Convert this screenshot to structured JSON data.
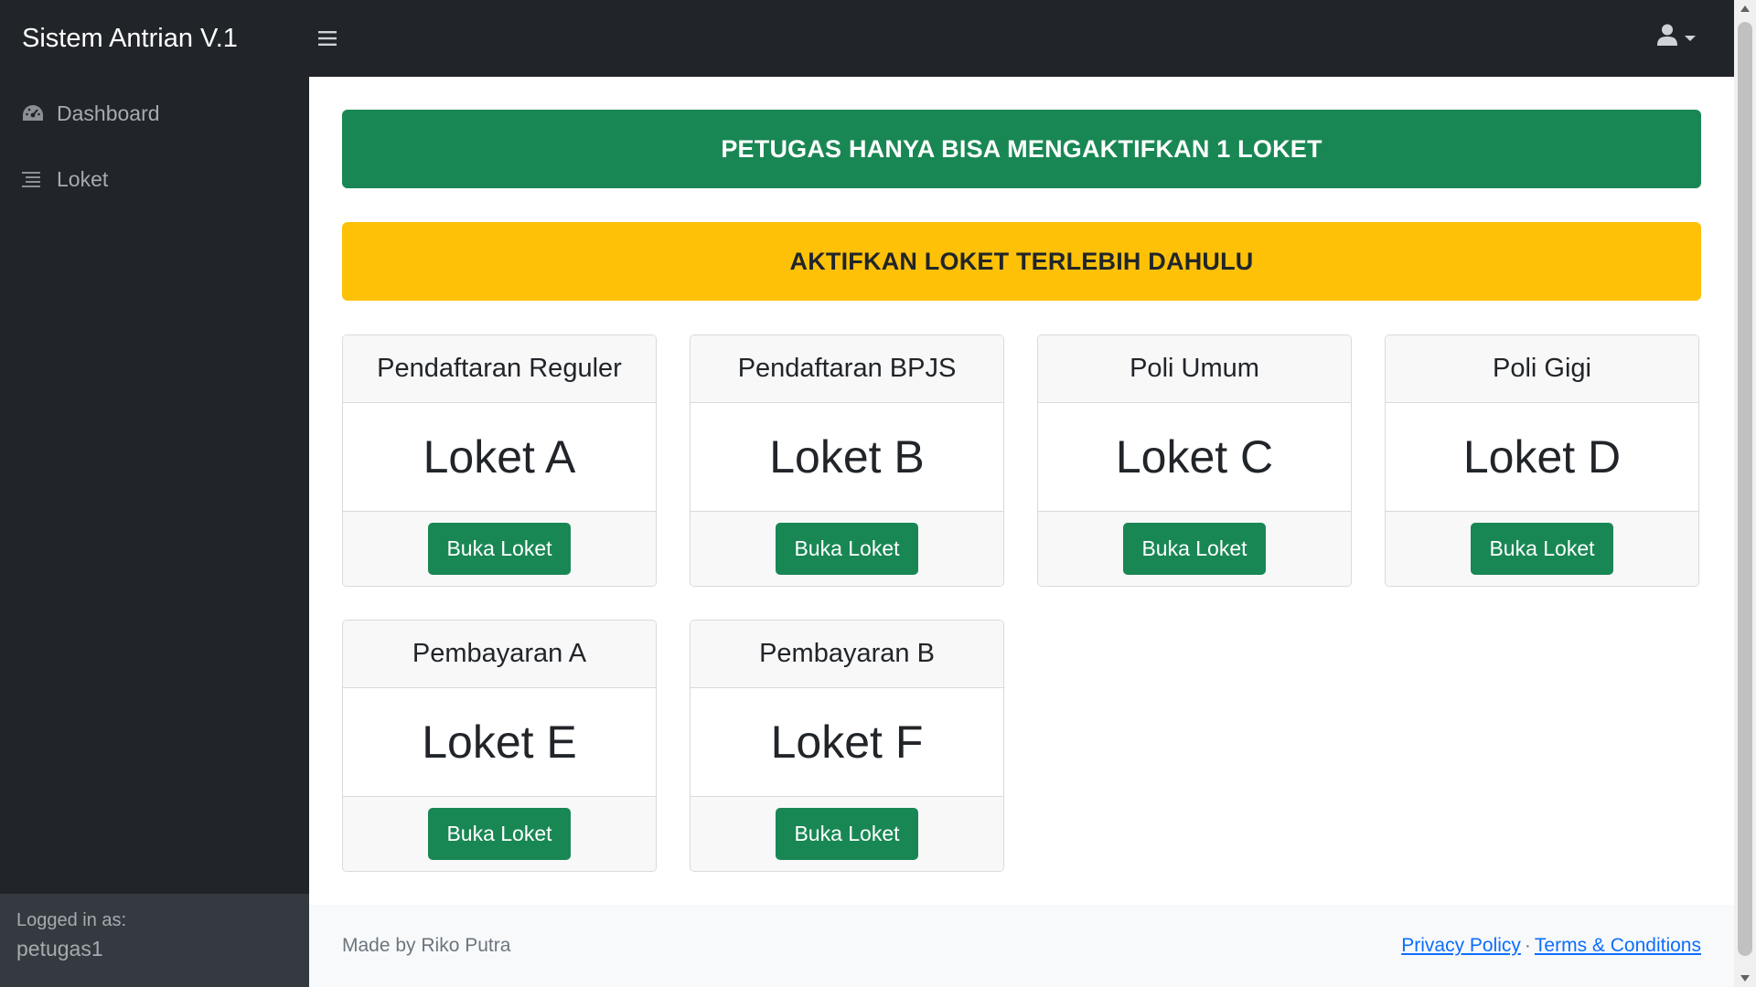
{
  "app": {
    "title": "Sistem Antrian V.1"
  },
  "topbar": {
    "toggle_icon": "menu-icon",
    "user_icon": "user-icon"
  },
  "sidebar": {
    "items": [
      {
        "label": "Dashboard",
        "icon": "dashboard-icon"
      },
      {
        "label": "Loket",
        "icon": "list-icon"
      }
    ],
    "footer": {
      "logged_in_label": "Logged in as:",
      "username": "petugas1"
    }
  },
  "banners": {
    "info": "PETUGAS HANYA BISA MENGAKTIFKAN 1 LOKET",
    "warning": "AKTIFKAN LOKET TERLEBIH DAHULU"
  },
  "counters": [
    {
      "service": "Pendaftaran Reguler",
      "name": "Loket A",
      "button": "Buka Loket"
    },
    {
      "service": "Pendaftaran BPJS",
      "name": "Loket B",
      "button": "Buka Loket"
    },
    {
      "service": "Poli Umum",
      "name": "Loket C",
      "button": "Buka Loket"
    },
    {
      "service": "Poli Gigi",
      "name": "Loket D",
      "button": "Buka Loket"
    },
    {
      "service": "Pembayaran A",
      "name": "Loket E",
      "button": "Buka Loket"
    },
    {
      "service": "Pembayaran B",
      "name": "Loket F",
      "button": "Buka Loket"
    }
  ],
  "footer": {
    "credit": "Made by Riko Putra",
    "privacy": "Privacy Policy",
    "separator": "·",
    "terms": "Terms & Conditions"
  },
  "colors": {
    "sidebar": "#212529",
    "success": "#198754",
    "warning": "#ffc107"
  }
}
